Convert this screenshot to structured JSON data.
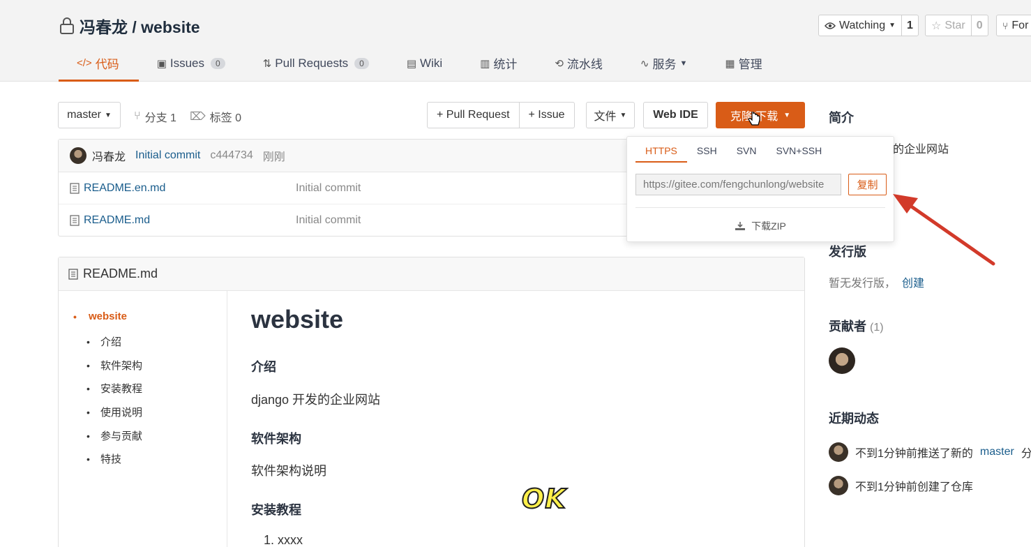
{
  "repo": {
    "title": "冯春龙 / website"
  },
  "top_buttons": {
    "watching_label": "Watching",
    "watching_count": "1",
    "star_label": "Star",
    "star_count": "0",
    "fork_label": "For"
  },
  "tabs": [
    {
      "label": "代码",
      "icon": "code-icon"
    },
    {
      "label": "Issues",
      "badge": "0",
      "icon": "issues-icon"
    },
    {
      "label": "Pull Requests",
      "badge": "0",
      "icon": "pull-request-icon"
    },
    {
      "label": "Wiki",
      "icon": "wiki-icon"
    },
    {
      "label": "统计",
      "icon": "chart-icon"
    },
    {
      "label": "流水线",
      "icon": "pipeline-icon"
    },
    {
      "label": "服务",
      "icon": "pulse-icon"
    },
    {
      "label": "管理",
      "icon": "manage-icon"
    }
  ],
  "toolbar": {
    "branch": "master",
    "branches": "分支 1",
    "tags": "标签 0",
    "pull_request": "+ Pull Request",
    "issue": "+ Issue",
    "file": "文件",
    "web_ide": "Web IDE",
    "clone": "克隆/下载"
  },
  "commit": {
    "author": "冯春龙",
    "message": "Initial commit",
    "hash": "c444734",
    "time": "刚刚"
  },
  "files": [
    {
      "name": "README.en.md",
      "message": "Initial commit"
    },
    {
      "name": "README.md",
      "message": "Initial commit"
    }
  ],
  "clone_dropdown": {
    "tabs": [
      "HTTPS",
      "SSH",
      "SVN",
      "SVN+SSH"
    ],
    "url": "https://gitee.com/fengchunlong/website",
    "copy": "复制",
    "zip": "下载ZIP"
  },
  "readme": {
    "header": "README.md",
    "toc": [
      "website",
      "介绍",
      "软件架构",
      "安装教程",
      "使用说明",
      "参与贡献",
      "特技"
    ],
    "h1": "website",
    "intro_heading": "介绍",
    "intro_text": "django 开发的企业网站",
    "arch_heading": "软件架构",
    "arch_text": "软件架构说明",
    "install_heading": "安装教程",
    "install_item": "1. xxxx"
  },
  "sidebar": {
    "intro_heading": "简介",
    "intro_text": "的企业网站",
    "release_heading": "发行版",
    "release_text": "暂无发行版，",
    "release_link": "创建",
    "contrib_heading": "贡献者",
    "contrib_count": "(1)",
    "activity_heading": "近期动态",
    "activity_1_prefix": "不到1分钟前推送了新的",
    "activity_1_branch": "master",
    "activity_1_suffix": "分",
    "activity_2": "不到1分钟前创建了仓库"
  },
  "overlay": {
    "ok_text": "OK",
    "arrow_color": "#d23a2a"
  },
  "colors": {
    "accent": "#d95c17",
    "link": "#1a5d8c"
  }
}
